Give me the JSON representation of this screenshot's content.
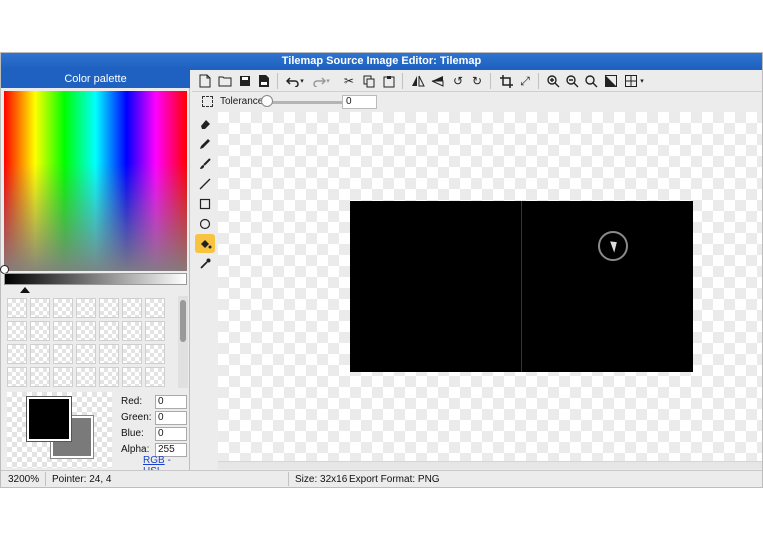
{
  "window": {
    "title": "Tilemap Source Image Editor: Tilemap"
  },
  "palette": {
    "header": "Color palette",
    "primary_color": "#000000",
    "secondary_color": "#7a7a7a",
    "channels": [
      {
        "label": "Red:",
        "value": "0"
      },
      {
        "label": "Green:",
        "value": "0"
      },
      {
        "label": "Blue:",
        "value": "0"
      },
      {
        "label": "Alpha:",
        "value": "255"
      }
    ],
    "mode_links": {
      "rgb": "RGB",
      "separator": "-",
      "hsl": "HSL"
    }
  },
  "toolbar": {
    "icons": [
      "new-file-icon",
      "open-folder-icon",
      "save-icon",
      "save-as-icon",
      "undo-icon",
      "redo-icon",
      "cut-icon",
      "copy-icon",
      "paste-icon",
      "flip-horizontal-icon",
      "flip-vertical-icon",
      "rotate-left-icon",
      "rotate-right-icon",
      "crop-icon",
      "resize-icon",
      "zoom-in-icon",
      "zoom-out-icon",
      "zoom-reset-icon",
      "contrast-icon",
      "grid-icon"
    ]
  },
  "options": {
    "tolerance_label": "Tolerance",
    "tolerance_value": "0",
    "tolerance_level": 0
  },
  "tools": [
    {
      "name": "eraser-icon",
      "active": false
    },
    {
      "name": "pencil-icon",
      "active": false
    },
    {
      "name": "brush-icon",
      "active": false
    },
    {
      "name": "line-icon",
      "active": false
    },
    {
      "name": "rectangle-icon",
      "active": false
    },
    {
      "name": "ellipse-icon",
      "active": false
    },
    {
      "name": "fill-bucket-icon",
      "active": true
    },
    {
      "name": "eyedropper-icon",
      "active": false
    }
  ],
  "canvas": {
    "image_fill": "#000000"
  },
  "status": {
    "zoom": "3200%",
    "pointer": "Pointer: 24, 4",
    "size": "Size: 32x16",
    "export_format": "Export Format: PNG"
  }
}
